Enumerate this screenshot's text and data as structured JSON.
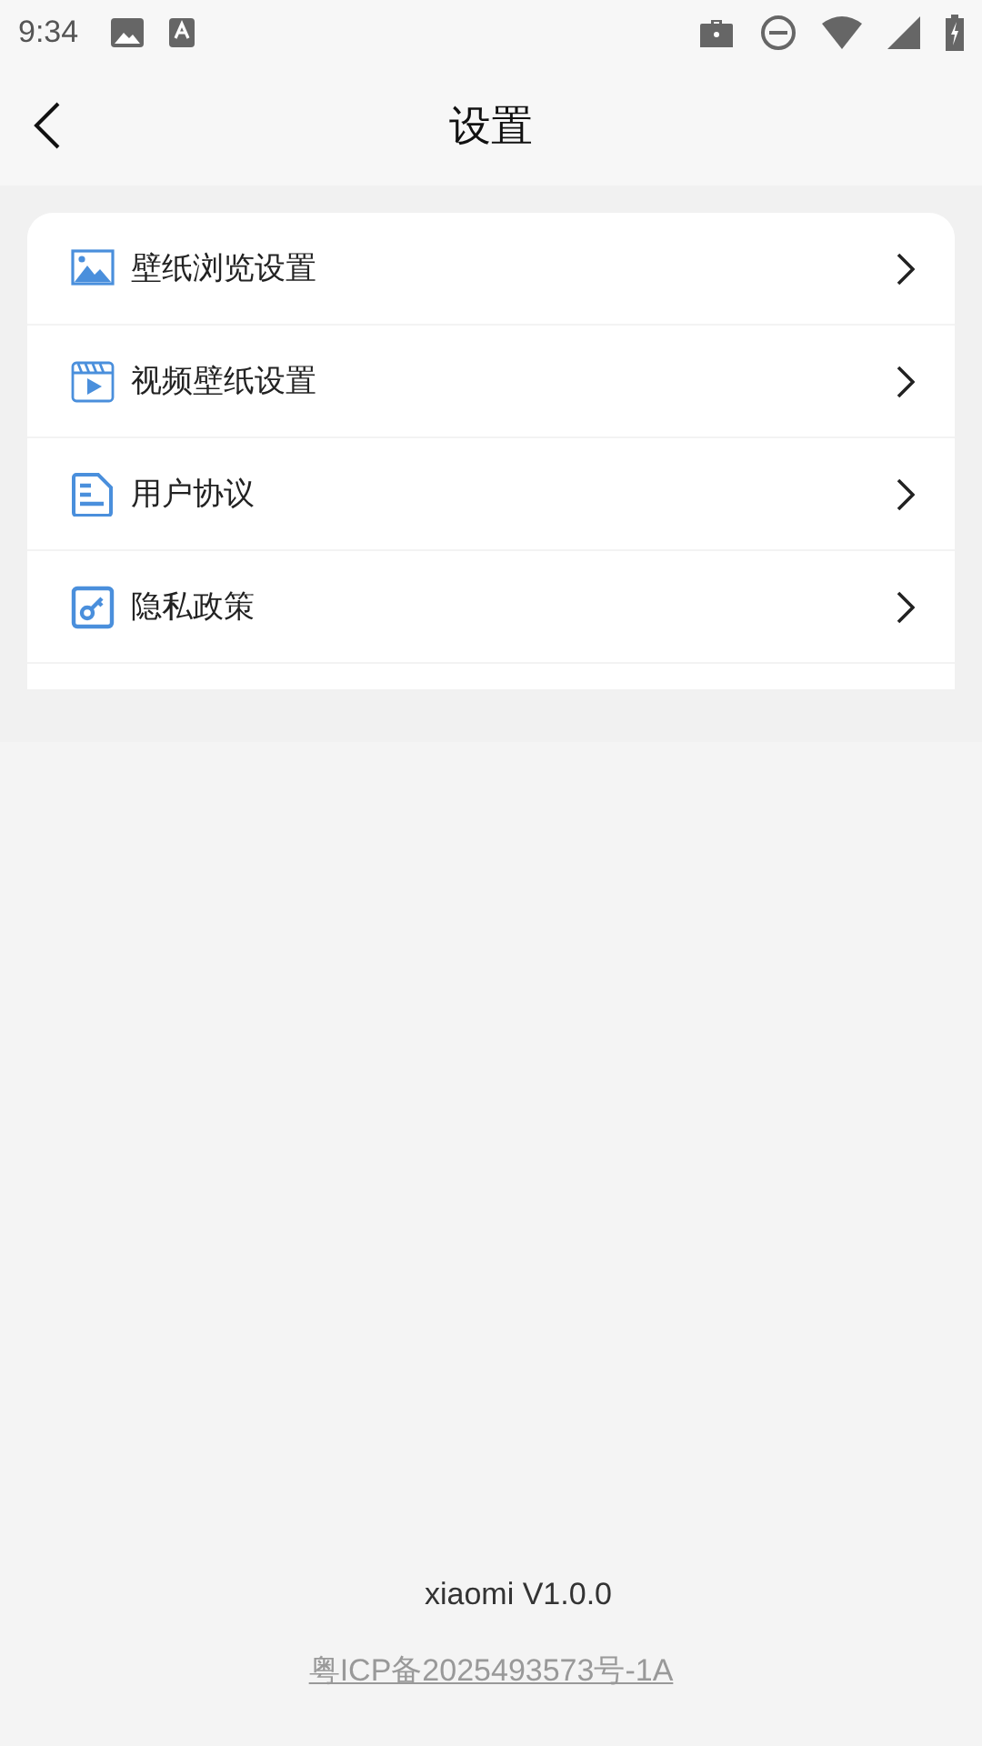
{
  "status_bar": {
    "time": "9:34"
  },
  "header": {
    "title": "设置"
  },
  "settings": [
    {
      "label": "壁纸浏览设置"
    },
    {
      "label": "视频壁纸设置"
    },
    {
      "label": "用户协议"
    },
    {
      "label": "隐私政策"
    }
  ],
  "footer": {
    "version": "xiaomi V1.0.0",
    "icp_link": "粤ICP备2025493573号-1A"
  }
}
